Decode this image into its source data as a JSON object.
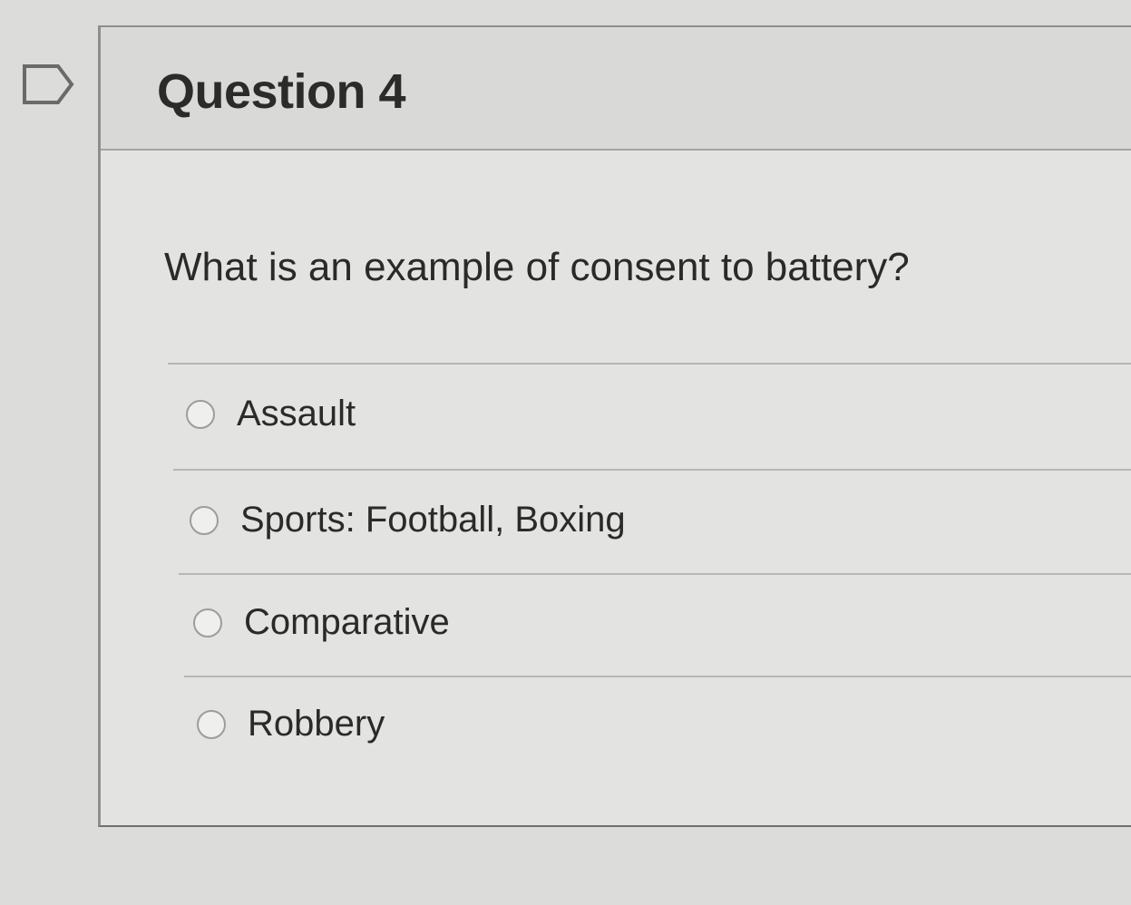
{
  "question": {
    "title": "Question 4",
    "prompt": "What is an example of consent to battery?",
    "flag_icon": "flag-icon",
    "options": [
      {
        "label": "Assault",
        "selected": false
      },
      {
        "label": "Sports: Football, Boxing",
        "selected": false
      },
      {
        "label": "Comparative",
        "selected": false
      },
      {
        "label": "Robbery",
        "selected": false
      }
    ]
  },
  "colors": {
    "background": "#dcdcda",
    "card": "#e3e3e1",
    "text": "#2a2a2a"
  }
}
